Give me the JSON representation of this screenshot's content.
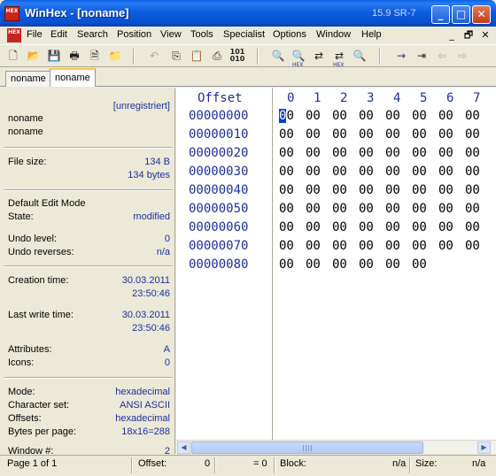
{
  "window": {
    "app_icon_text": "HEX",
    "title": "WinHex - [noname]",
    "version": "15.9 SR-7",
    "buttons": {
      "minimize": "_",
      "maximize": "□",
      "close": "✕"
    }
  },
  "menu": {
    "items": [
      "File",
      "Edit",
      "Search",
      "Position",
      "View",
      "Tools",
      "Specialist",
      "Options",
      "Window",
      "Help"
    ],
    "mdi_buttons": [
      "_",
      "🗗",
      "✕"
    ]
  },
  "toolbar": {
    "icons": [
      "new-file-icon",
      "open-icon",
      "save-icon",
      "print-icon",
      "properties-icon",
      "export-icon",
      "undo-icon",
      "copy-icon",
      "paste-icon",
      "write-icon",
      "binary-icon",
      "find-icon",
      "find-hex-icon",
      "replace-icon",
      "replace-hex-icon",
      "find-next-icon",
      "goto-icon",
      "goto-offset-icon",
      "back-icon",
      "forward-icon"
    ],
    "binary_label": "101\n010",
    "hex_sub": "HEX"
  },
  "tabs": [
    "noname",
    "noname"
  ],
  "info_panel": {
    "registration": "[unregistriert]",
    "filename1": "noname",
    "filename2": "noname",
    "file_size_label": "File size:",
    "file_size_bytes_short": "134 B",
    "file_size_bytes_long": "134 bytes",
    "edit_mode_label": "Default Edit Mode",
    "state_label": "State:",
    "state_value": "modified",
    "undo_level_label": "Undo level:",
    "undo_level_value": "0",
    "undo_reverses_label": "Undo reverses:",
    "undo_reverses_value": "n/a",
    "creation_label": "Creation time:",
    "creation_date": "30.03.2011",
    "creation_time": "23:50:46",
    "lastwrite_label": "Last write time:",
    "lastwrite_date": "30.03.2011",
    "lastwrite_time": "23:50:46",
    "attributes_label": "Attributes:",
    "attributes_value": "A",
    "icons_label": "Icons:",
    "icons_value": "0",
    "mode_label": "Mode:",
    "mode_value": "hexadecimal",
    "charset_label": "Character set:",
    "charset_value": "ANSI ASCII",
    "offsets_label": "Offsets:",
    "offsets_value": "hexadecimal",
    "bpp_label": "Bytes per page:",
    "bpp_value": "18x16=288",
    "window_label": "Window #:",
    "window_value": "2"
  },
  "hex_view": {
    "offset_header": "Offset",
    "column_headers": [
      "0",
      "1",
      "2",
      "3",
      "4",
      "5",
      "6",
      "7"
    ],
    "rows": [
      {
        "offset": "00000000",
        "bytes": [
          "00",
          "00",
          "00",
          "00",
          "00",
          "00",
          "00",
          "00"
        ]
      },
      {
        "offset": "00000010",
        "bytes": [
          "00",
          "00",
          "00",
          "00",
          "00",
          "00",
          "00",
          "00"
        ]
      },
      {
        "offset": "00000020",
        "bytes": [
          "00",
          "00",
          "00",
          "00",
          "00",
          "00",
          "00",
          "00"
        ]
      },
      {
        "offset": "00000030",
        "bytes": [
          "00",
          "00",
          "00",
          "00",
          "00",
          "00",
          "00",
          "00"
        ]
      },
      {
        "offset": "00000040",
        "bytes": [
          "00",
          "00",
          "00",
          "00",
          "00",
          "00",
          "00",
          "00"
        ]
      },
      {
        "offset": "00000050",
        "bytes": [
          "00",
          "00",
          "00",
          "00",
          "00",
          "00",
          "00",
          "00"
        ]
      },
      {
        "offset": "00000060",
        "bytes": [
          "00",
          "00",
          "00",
          "00",
          "00",
          "00",
          "00",
          "00"
        ]
      },
      {
        "offset": "00000070",
        "bytes": [
          "00",
          "00",
          "00",
          "00",
          "00",
          "00",
          "00",
          "00"
        ]
      },
      {
        "offset": "00000080",
        "bytes": [
          "00",
          "00",
          "00",
          "00",
          "00",
          "00"
        ]
      }
    ]
  },
  "status_bar": {
    "page": "Page 1 of 1",
    "offset_label": "Offset:",
    "offset_value": "0",
    "offset_eq": "= 0",
    "block_label": "Block:",
    "block_value": "n/a",
    "size_label": "Size:",
    "size_value": "n/a"
  }
}
